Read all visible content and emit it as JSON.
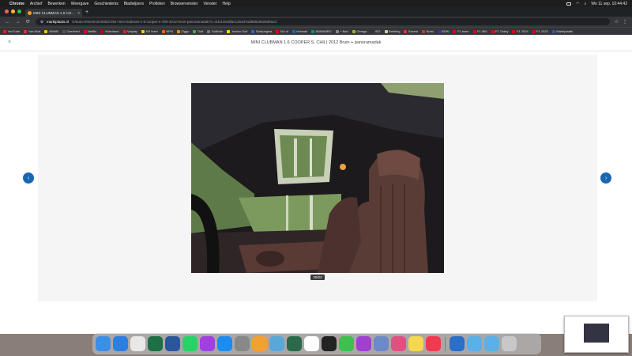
{
  "menubar": {
    "app": "Chrome",
    "items": [
      "Archief",
      "Bewerken",
      "Weergave",
      "Geschiedenis",
      "Bladwijzers",
      "Profielen",
      "Browservenster",
      "Venster",
      "Help"
    ],
    "clock": "Wo 11 sep.  10:44:42"
  },
  "tab": {
    "title": "MINI CLUBMAN 1.6 COOPER",
    "close": "×",
    "new_tab": "+"
  },
  "toolbar": {
    "back": "←",
    "forward": "→",
    "reload": "⟳",
    "url_host": "marktplaats.nl",
    "url_path": "/v/auto-s/mini/m2100537261-mini-clubman-1-6-cooper-s-chili-2012-bruin-panoramadak?c=4dc4183dfac1254d7ad85846826d0acd",
    "icons": [
      "☆",
      "⋮"
    ]
  },
  "bookmarks": [
    {
      "label": "YouTube",
      "color": "#e62117"
    },
    {
      "label": "Yaa Kids",
      "color": "#d33"
    },
    {
      "label": "ANWB",
      "color": "#f5c400"
    },
    {
      "label": "Overheid",
      "color": "#555"
    },
    {
      "label": "Netflix",
      "color": "#e50914"
    },
    {
      "label": "Videoland",
      "color": "#c00"
    },
    {
      "label": "Viaplay",
      "color": "#d22"
    },
    {
      "label": "NS Hare",
      "color": "#ffc917"
    },
    {
      "label": "NPN",
      "color": "#f60"
    },
    {
      "label": "Ziggo",
      "color": "#f48c00"
    },
    {
      "label": "Golf",
      "color": "#4a4"
    },
    {
      "label": "Golfclub",
      "color": "#777"
    },
    {
      "label": "Jumbo Golf",
      "color": "#fd0"
    },
    {
      "label": "Startpagina",
      "color": "#36c"
    },
    {
      "label": "NU.nl",
      "color": "#e00"
    },
    {
      "label": "Hotmail",
      "color": "#0072c6"
    },
    {
      "label": "ABNAMRO",
      "color": "#009286"
    },
    {
      "label": "+ Bad",
      "color": "#888"
    },
    {
      "label": "Omega",
      "color": "#aa3"
    },
    {
      "label": "iSG",
      "color": "#333"
    },
    {
      "label": "Breitling",
      "color": "#cc9"
    },
    {
      "label": "Essent",
      "color": "#e33"
    },
    {
      "label": "Bolai",
      "color": "#c33"
    },
    {
      "label": "BDW",
      "color": "#33a"
    },
    {
      "label": "F1 team",
      "color": "#e10600"
    },
    {
      "label": "F1.360",
      "color": "#e10600"
    },
    {
      "label": "F1 Today",
      "color": "#e10600"
    },
    {
      "label": "F1 2024",
      "color": "#e10600"
    },
    {
      "label": "F1 2023",
      "color": "#e10600"
    },
    {
      "label": "Marktplaats",
      "color": "#2e5ba8"
    }
  ],
  "page": {
    "title": "MINI CLUBMAN 1.6 COOPER S. CHILI 2012 Bruin + panoramadak",
    "close": "×",
    "counter": "20/22",
    "prev": "‹",
    "next": "›"
  },
  "dock": [
    {
      "name": "finder-icon",
      "color": "#3b8fe5"
    },
    {
      "name": "safari-icon",
      "color": "#2a7fe0"
    },
    {
      "name": "chrome-icon",
      "color": "#e8e8e8"
    },
    {
      "name": "excel-icon",
      "color": "#1d7044"
    },
    {
      "name": "word-icon",
      "color": "#2b579a"
    },
    {
      "name": "whatsapp-icon",
      "color": "#25d366"
    },
    {
      "name": "messenger-icon",
      "color": "#a040e0"
    },
    {
      "name": "app-store-icon",
      "color": "#1c8cf0"
    },
    {
      "name": "system-settings-icon",
      "color": "#888"
    },
    {
      "name": "photos-icon",
      "color": "#f2a030"
    },
    {
      "name": "preview-icon",
      "color": "#5aa8d8"
    },
    {
      "name": "time-machine-icon",
      "color": "#2a6a4a"
    },
    {
      "name": "calendar-icon",
      "color": "#ffffff"
    },
    {
      "name": "clock-icon",
      "color": "#222"
    },
    {
      "name": "facetime-icon",
      "color": "#3cc050"
    },
    {
      "name": "podcasts-icon",
      "color": "#a040d0"
    },
    {
      "name": "screen-sharing-icon",
      "color": "#6a8ac8"
    },
    {
      "name": "launchpad-icon",
      "color": "#e05080"
    },
    {
      "name": "notes-icon",
      "color": "#f5d850"
    },
    {
      "name": "music-icon",
      "color": "#f03a50"
    },
    {
      "name": "bluetooth-icon",
      "color": "#2a70c8"
    },
    {
      "name": "downloads-folder-icon",
      "color": "#5ab0e8"
    },
    {
      "name": "documents-folder-icon",
      "color": "#5ab0e8"
    },
    {
      "name": "trash-icon",
      "color": "#c8c8c8"
    }
  ],
  "colors": {
    "accent": "#1a66b3",
    "page_bg": "#ffffff",
    "viewer_bg": "#f5f5f5"
  }
}
